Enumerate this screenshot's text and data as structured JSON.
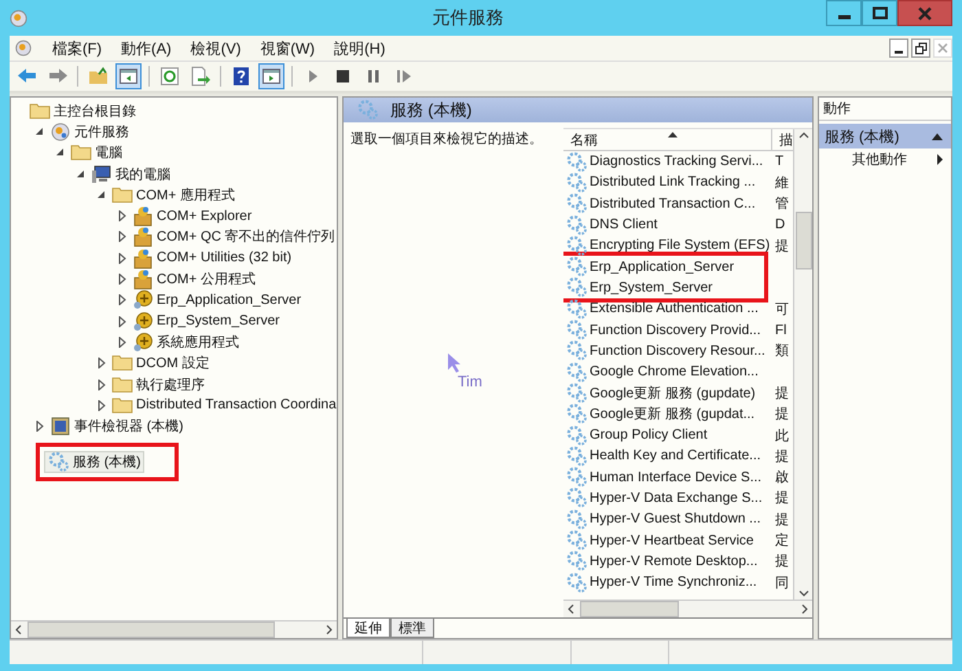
{
  "window": {
    "title": "元件服務"
  },
  "menu": [
    "檔案(F)",
    "動作(A)",
    "檢視(V)",
    "視窗(W)",
    "說明(H)"
  ],
  "toolbar": [
    {
      "kind": "back",
      "pressed": false
    },
    {
      "kind": "forward",
      "pressed": false
    },
    {
      "kind": "sep"
    },
    {
      "kind": "up",
      "pressed": false
    },
    {
      "kind": "tree",
      "pressed": true
    },
    {
      "kind": "sep"
    },
    {
      "kind": "refresh",
      "pressed": false
    },
    {
      "kind": "export",
      "pressed": false
    },
    {
      "kind": "sep"
    },
    {
      "kind": "help",
      "pressed": false
    },
    {
      "kind": "pane",
      "pressed": true
    },
    {
      "kind": "sep"
    },
    {
      "kind": "play",
      "pressed": false
    },
    {
      "kind": "stop",
      "pressed": false
    },
    {
      "kind": "pause",
      "pressed": false
    },
    {
      "kind": "resume",
      "pressed": false
    }
  ],
  "tree": [
    {
      "label": "主控台根目錄",
      "kind": "folder",
      "expandable": false,
      "selected": false,
      "highlighted": false,
      "children": [
        {
          "label": "元件服務",
          "kind": "component",
          "expandable": true,
          "expanded": true,
          "selected": false,
          "highlighted": false,
          "children": [
            {
              "label": "電腦",
              "kind": "folder",
              "expandable": true,
              "expanded": true,
              "selected": false,
              "highlighted": false,
              "children": [
                {
                  "label": "我的電腦",
                  "kind": "computer",
                  "expandable": true,
                  "expanded": true,
                  "selected": false,
                  "highlighted": false,
                  "children": [
                    {
                      "label": "COM+ 應用程式",
                      "kind": "folder",
                      "expandable": true,
                      "expanded": true,
                      "selected": false,
                      "highlighted": false,
                      "children": [
                        {
                          "label": "COM+ Explorer",
                          "kind": "appbox",
                          "expandable": true,
                          "expanded": false,
                          "selected": false,
                          "highlighted": false
                        },
                        {
                          "label": "COM+ QC 寄不出的信件佇列",
                          "kind": "appbox",
                          "expandable": true,
                          "expanded": false,
                          "selected": false,
                          "highlighted": false
                        },
                        {
                          "label": "COM+ Utilities (32 bit)",
                          "kind": "appbox",
                          "expandable": true,
                          "expanded": false,
                          "selected": false,
                          "highlighted": false
                        },
                        {
                          "label": "COM+ 公用程式",
                          "kind": "appbox",
                          "expandable": true,
                          "expanded": false,
                          "selected": false,
                          "highlighted": false
                        },
                        {
                          "label": "Erp_Application_Server",
                          "kind": "appball",
                          "expandable": true,
                          "expanded": false,
                          "selected": false,
                          "highlighted": false
                        },
                        {
                          "label": "Erp_System_Server",
                          "kind": "appball",
                          "expandable": true,
                          "expanded": false,
                          "selected": false,
                          "highlighted": false
                        },
                        {
                          "label": "系統應用程式",
                          "kind": "appball",
                          "expandable": true,
                          "expanded": false,
                          "selected": false,
                          "highlighted": false
                        }
                      ]
                    },
                    {
                      "label": "DCOM 設定",
                      "kind": "folder",
                      "expandable": true,
                      "expanded": false,
                      "selected": false,
                      "highlighted": false
                    },
                    {
                      "label": "執行處理序",
                      "kind": "folder",
                      "expandable": true,
                      "expanded": false,
                      "selected": false,
                      "highlighted": false
                    },
                    {
                      "label": "Distributed Transaction Coordina",
                      "kind": "folder",
                      "expandable": true,
                      "expanded": false,
                      "selected": false,
                      "highlighted": false
                    }
                  ]
                }
              ]
            }
          ]
        },
        {
          "label": "事件檢視器 (本機)",
          "kind": "eventlog",
          "expandable": true,
          "expanded": false,
          "selected": false,
          "highlighted": false
        },
        {
          "label": "服務 (本機)",
          "kind": "gear",
          "expandable": false,
          "selected": true,
          "highlighted": true
        }
      ]
    }
  ],
  "content": {
    "header": "服務 (本機)",
    "description": "選取一個項目來檢視它的描述。",
    "cursor_label": "Tim",
    "columns": [
      {
        "label": "名稱",
        "sorted": true
      },
      {
        "label": "描",
        "sorted": false
      }
    ],
    "rows": [
      {
        "name": "Diagnostics Tracking Servi...",
        "column_2": "T",
        "highlighted": false
      },
      {
        "name": "Distributed Link Tracking ...",
        "column_2": "維",
        "highlighted": false
      },
      {
        "name": "Distributed Transaction C...",
        "column_2": "管",
        "highlighted": false
      },
      {
        "name": "DNS Client",
        "column_2": "D",
        "highlighted": false
      },
      {
        "name": "Encrypting File System (EFS)",
        "column_2": "提",
        "highlighted": false
      },
      {
        "name": "Erp_Application_Server",
        "highlighted": true
      },
      {
        "name": "Erp_System_Server",
        "highlighted": true
      },
      {
        "name": "Extensible Authentication ...",
        "column_2": "可",
        "highlighted": false
      },
      {
        "name": "Function Discovery Provid...",
        "column_2": "Fl",
        "highlighted": false
      },
      {
        "name": "Function Discovery Resour...",
        "column_2": "類",
        "highlighted": false
      },
      {
        "name": "Google Chrome Elevation...",
        "highlighted": false
      },
      {
        "name": "Google更新 服務 (gupdate)",
        "column_2": "提",
        "highlighted": false
      },
      {
        "name": "Google更新 服務 (gupdat...",
        "column_2": "提",
        "highlighted": false
      },
      {
        "name": "Group Policy Client",
        "column_2": "此",
        "highlighted": false
      },
      {
        "name": "Health Key and Certificate...",
        "column_2": "提",
        "highlighted": false
      },
      {
        "name": "Human Interface Device S...",
        "column_2": "啟",
        "highlighted": false
      },
      {
        "name": "Hyper-V Data Exchange S...",
        "column_2": "提",
        "highlighted": false
      },
      {
        "name": "Hyper-V Guest Shutdown ...",
        "column_2": "提",
        "highlighted": false
      },
      {
        "name": "Hyper-V Heartbeat Service",
        "column_2": "定",
        "highlighted": false
      },
      {
        "name": "Hyper-V Remote Desktop...",
        "column_2": "提",
        "highlighted": false
      },
      {
        "name": "Hyper-V Time Synchroniz...",
        "column_2": "同",
        "highlighted": false
      }
    ],
    "tabs": [
      {
        "label": "延伸",
        "selected": true
      },
      {
        "label": "標準",
        "selected": false
      }
    ]
  },
  "actions": {
    "title": "動作",
    "sections": [
      {
        "label": "服務 (本機)",
        "expanded": true,
        "items": [
          {
            "label": "其他動作",
            "submenu": true
          }
        ]
      }
    ]
  }
}
